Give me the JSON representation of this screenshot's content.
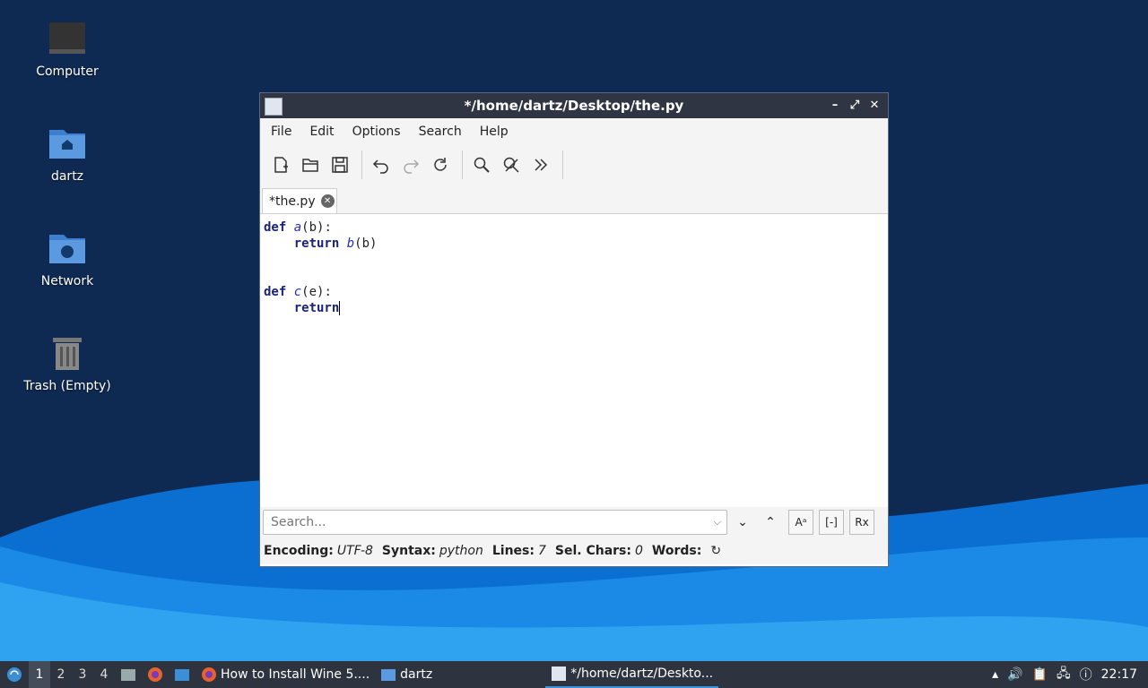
{
  "desktop": {
    "icons": [
      {
        "label": "Computer"
      },
      {
        "label": "dartz"
      },
      {
        "label": "Network"
      },
      {
        "label": "Trash (Empty)"
      }
    ]
  },
  "window": {
    "title": "*/home/dartz/Desktop/the.py",
    "menu": [
      "File",
      "Edit",
      "Options",
      "Search",
      "Help"
    ],
    "tab_label": "*the.py",
    "code": {
      "line1_kw": "def",
      "line1_fn": "a",
      "line1_rest": "(b):",
      "line2_kw": "return",
      "line2_fn": "b",
      "line2_rest": "(b)",
      "line5_kw": "def",
      "line5_fn": "c",
      "line5_rest": "(e):",
      "line6_kw": "return"
    },
    "search": {
      "placeholder": "Search..."
    },
    "status": {
      "encoding_label": "Encoding:",
      "encoding_value": "UTF-8",
      "syntax_label": "Syntax:",
      "syntax_value": "python",
      "lines_label": "Lines:",
      "lines_value": "7",
      "sel_label": "Sel. Chars:",
      "sel_value": "0",
      "words_label": "Words:"
    }
  },
  "taskbar": {
    "workspaces": [
      "1",
      "2",
      "3",
      "4"
    ],
    "tasks": [
      {
        "label": "How to Install Wine 5...."
      },
      {
        "label": "dartz"
      },
      {
        "label": "*/home/dartz/Deskto..."
      }
    ],
    "clock": "22:17"
  },
  "colors": {
    "accent": "#3b8fd6",
    "keyword": "#1a237e",
    "function": "#2431b3"
  }
}
